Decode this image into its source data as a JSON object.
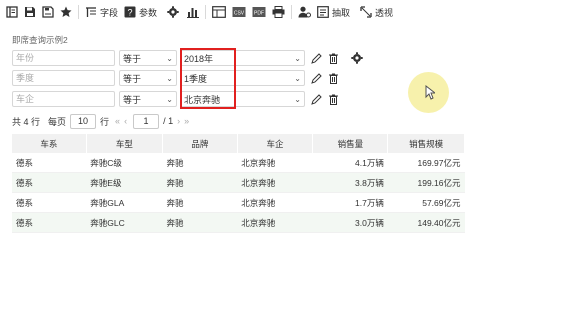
{
  "toolbar": {
    "items": [
      {
        "icon": "settings-panel-icon"
      },
      {
        "icon": "save-icon"
      },
      {
        "icon": "save-as-icon"
      },
      {
        "icon": "star-icon"
      },
      {
        "icon": "field-icon",
        "label": "字段"
      },
      {
        "icon": "param-icon",
        "label": "参数"
      },
      {
        "icon": "gear-icon"
      },
      {
        "icon": "chart-icon"
      },
      {
        "icon": "table-icon"
      },
      {
        "icon": "export-icon"
      },
      {
        "icon": "export-pdf-icon"
      },
      {
        "icon": "print-icon"
      },
      {
        "icon": "user-settings-icon"
      },
      {
        "icon": "extract-icon",
        "label": "抽取"
      },
      {
        "icon": "pivot-icon",
        "label": "透视"
      }
    ]
  },
  "form_title": "即席查询示例2",
  "filters": [
    {
      "field": "年份",
      "operator": "等于",
      "value": "2018年"
    },
    {
      "field": "季度",
      "operator": "等于",
      "value": "1季度"
    },
    {
      "field": "车企",
      "operator": "等于",
      "value": "北京奔驰"
    }
  ],
  "pager": {
    "total_label": "共 4 行",
    "per_page_label": "每页",
    "per_page_value": "10",
    "row_unit": "行",
    "current_page": "1",
    "total_pages": "/ 1"
  },
  "table": {
    "columns": [
      "车系",
      "车型",
      "品牌",
      "车企",
      "销售量",
      "销售规模"
    ],
    "rows": [
      [
        "德系",
        "奔驰C级",
        "奔驰",
        "北京奔驰",
        "4.1万辆",
        "169.97亿元"
      ],
      [
        "德系",
        "奔驰E级",
        "奔驰",
        "北京奔驰",
        "3.8万辆",
        "199.16亿元"
      ],
      [
        "德系",
        "奔驰GLA",
        "奔驰",
        "北京奔驰",
        "1.7万辆",
        "57.69亿元"
      ],
      [
        "德系",
        "奔驰GLC",
        "奔驰",
        "北京奔驰",
        "3.0万辆",
        "149.40亿元"
      ]
    ]
  },
  "colors": {
    "highlight": "#e1201f",
    "cursor_halo": "#f6ef9e",
    "header_bg": "#f1f1f1",
    "alt_row_bg": "#f3f8f3"
  }
}
